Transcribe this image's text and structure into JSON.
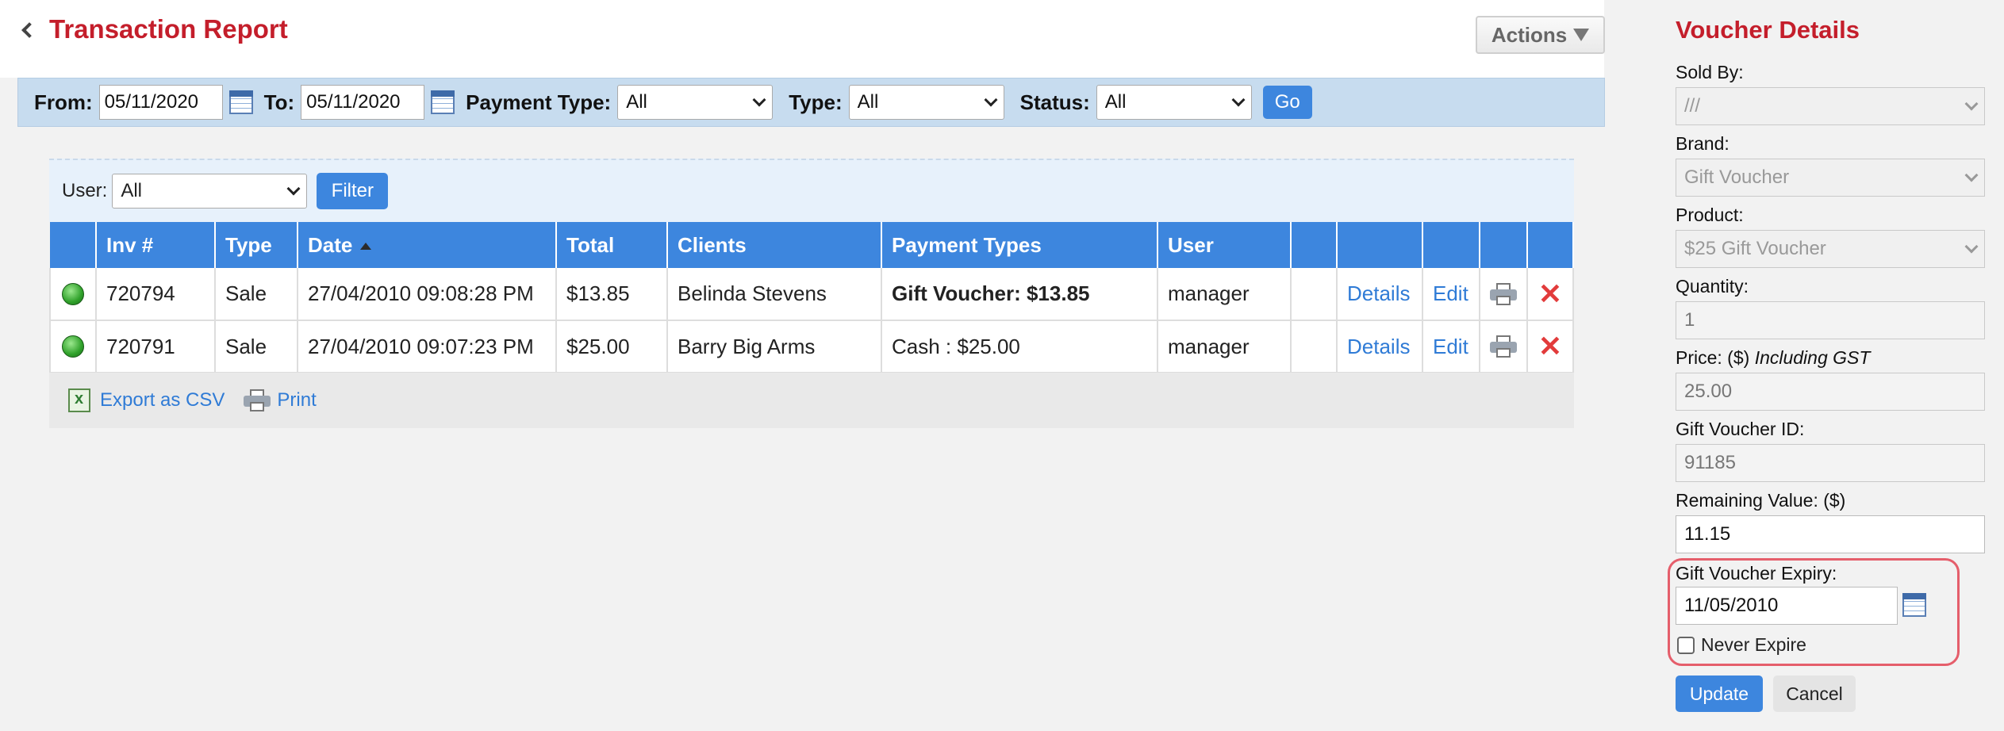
{
  "header": {
    "title": "Transaction Report",
    "actions_label": "Actions"
  },
  "filters": {
    "from_label": "From:",
    "from_value": "05/11/2020",
    "to_label": "To:",
    "to_value": "05/11/2020",
    "payment_type_label": "Payment Type:",
    "payment_type_value": "All",
    "type_label": "Type:",
    "type_value": "All",
    "status_label": "Status:",
    "status_value": "All",
    "go_label": "Go"
  },
  "user_filter": {
    "label": "User:",
    "value": "All",
    "button": "Filter"
  },
  "table": {
    "columns": [
      "",
      "Inv #",
      "Type",
      "Date",
      "Total",
      "Clients",
      "Payment Types",
      "User",
      "",
      "",
      "",
      "",
      ""
    ],
    "rows": [
      {
        "inv": "720794",
        "type": "Sale",
        "date": "27/04/2010 09:08:28 PM",
        "total": "$13.85",
        "client": "Belinda Stevens",
        "payment": "Gift Voucher: $13.85",
        "user": "manager",
        "details": "Details",
        "edit": "Edit"
      },
      {
        "inv": "720791",
        "type": "Sale",
        "date": "27/04/2010 09:07:23 PM",
        "total": "$25.00",
        "client": "Barry Big Arms",
        "payment": "Cash : $25.00",
        "user": "manager",
        "details": "Details",
        "edit": "Edit"
      }
    ]
  },
  "footer": {
    "export_label": "Export as CSV",
    "print_label": "Print"
  },
  "voucher": {
    "title": "Voucher Details",
    "sold_by_label": "Sold By:",
    "sold_by_value": "///",
    "brand_label": "Brand:",
    "brand_value": "Gift Voucher",
    "product_label": "Product:",
    "product_value": "$25 Gift Voucher",
    "quantity_label": "Quantity:",
    "quantity_value": "1",
    "price_label": "Price: ($)",
    "price_note": "Including GST",
    "price_value": "25.00",
    "id_label": "Gift Voucher ID:",
    "id_value": "91185",
    "remaining_label": "Remaining Value: ($)",
    "remaining_value": "11.15",
    "expiry_label": "Gift Voucher Expiry:",
    "expiry_value": "11/05/2010",
    "never_expire_label": "Never Expire",
    "update_label": "Update",
    "cancel_label": "Cancel"
  },
  "colors": {
    "title_red": "#c41e2b",
    "header_blue": "#3d86de",
    "filter_bar": "#c7dcef",
    "highlight_border": "#e55e6b"
  }
}
